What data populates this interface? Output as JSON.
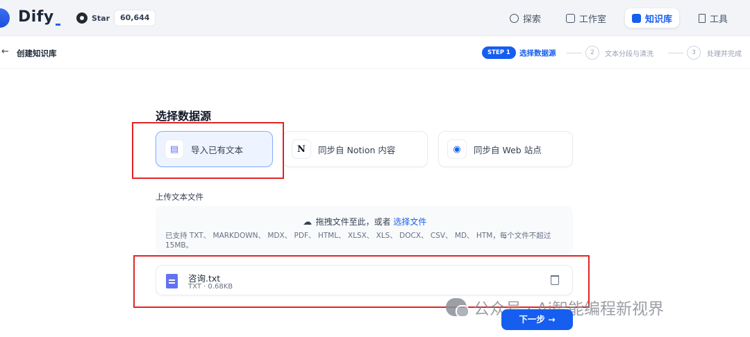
{
  "app": {
    "name": "Dify"
  },
  "github": {
    "star_label": "Star",
    "star_count": "60,644"
  },
  "nav": [
    {
      "label": "探索",
      "icon": "explore-icon",
      "active": false
    },
    {
      "label": "工作室",
      "icon": "robot-icon",
      "active": false
    },
    {
      "label": "知识库",
      "icon": "book-icon",
      "active": true
    },
    {
      "label": "工具",
      "icon": "hammer-icon",
      "active": false
    }
  ],
  "header": {
    "back_icon": "←",
    "title": "创建知识库"
  },
  "steps": [
    {
      "badge": "STEP 1",
      "label": "选择数据源",
      "active": true
    },
    {
      "number": "2",
      "label": "文本分段与清洗",
      "active": false
    },
    {
      "number": "3",
      "label": "处理并完成",
      "active": false
    }
  ],
  "main": {
    "section_title": "选择数据源",
    "sources": [
      {
        "label": "导入已有文本",
        "icon": "document-icon",
        "icon_glyph": "▤",
        "active": true
      },
      {
        "label": "同步自 Notion 内容",
        "icon": "notion-icon",
        "icon_glyph": "N",
        "active": false
      },
      {
        "label": "同步自 Web 站点",
        "icon": "web-icon",
        "icon_glyph": "◉",
        "active": false
      }
    ],
    "upload": {
      "label": "上传文本文件",
      "drag_text": "拖拽文件至此，或者",
      "select_link": "选择文件",
      "hint": "已支持 TXT、 MARKDOWN、 MDX、 PDF、 HTML、 XLSX、 XLS、 DOCX、 CSV、 MD、 HTM，每个文件不超过 15MB。"
    },
    "file": {
      "name": "咨询.txt",
      "meta": "TXT · 0.68KB"
    },
    "next_button": "下一步 →"
  },
  "watermark": {
    "text": "公众号 · Ai智能编程新视界"
  },
  "colors": {
    "primary": "#155eef",
    "highlight_border": "#e02424",
    "active_card_bg": "#eef4ff"
  }
}
